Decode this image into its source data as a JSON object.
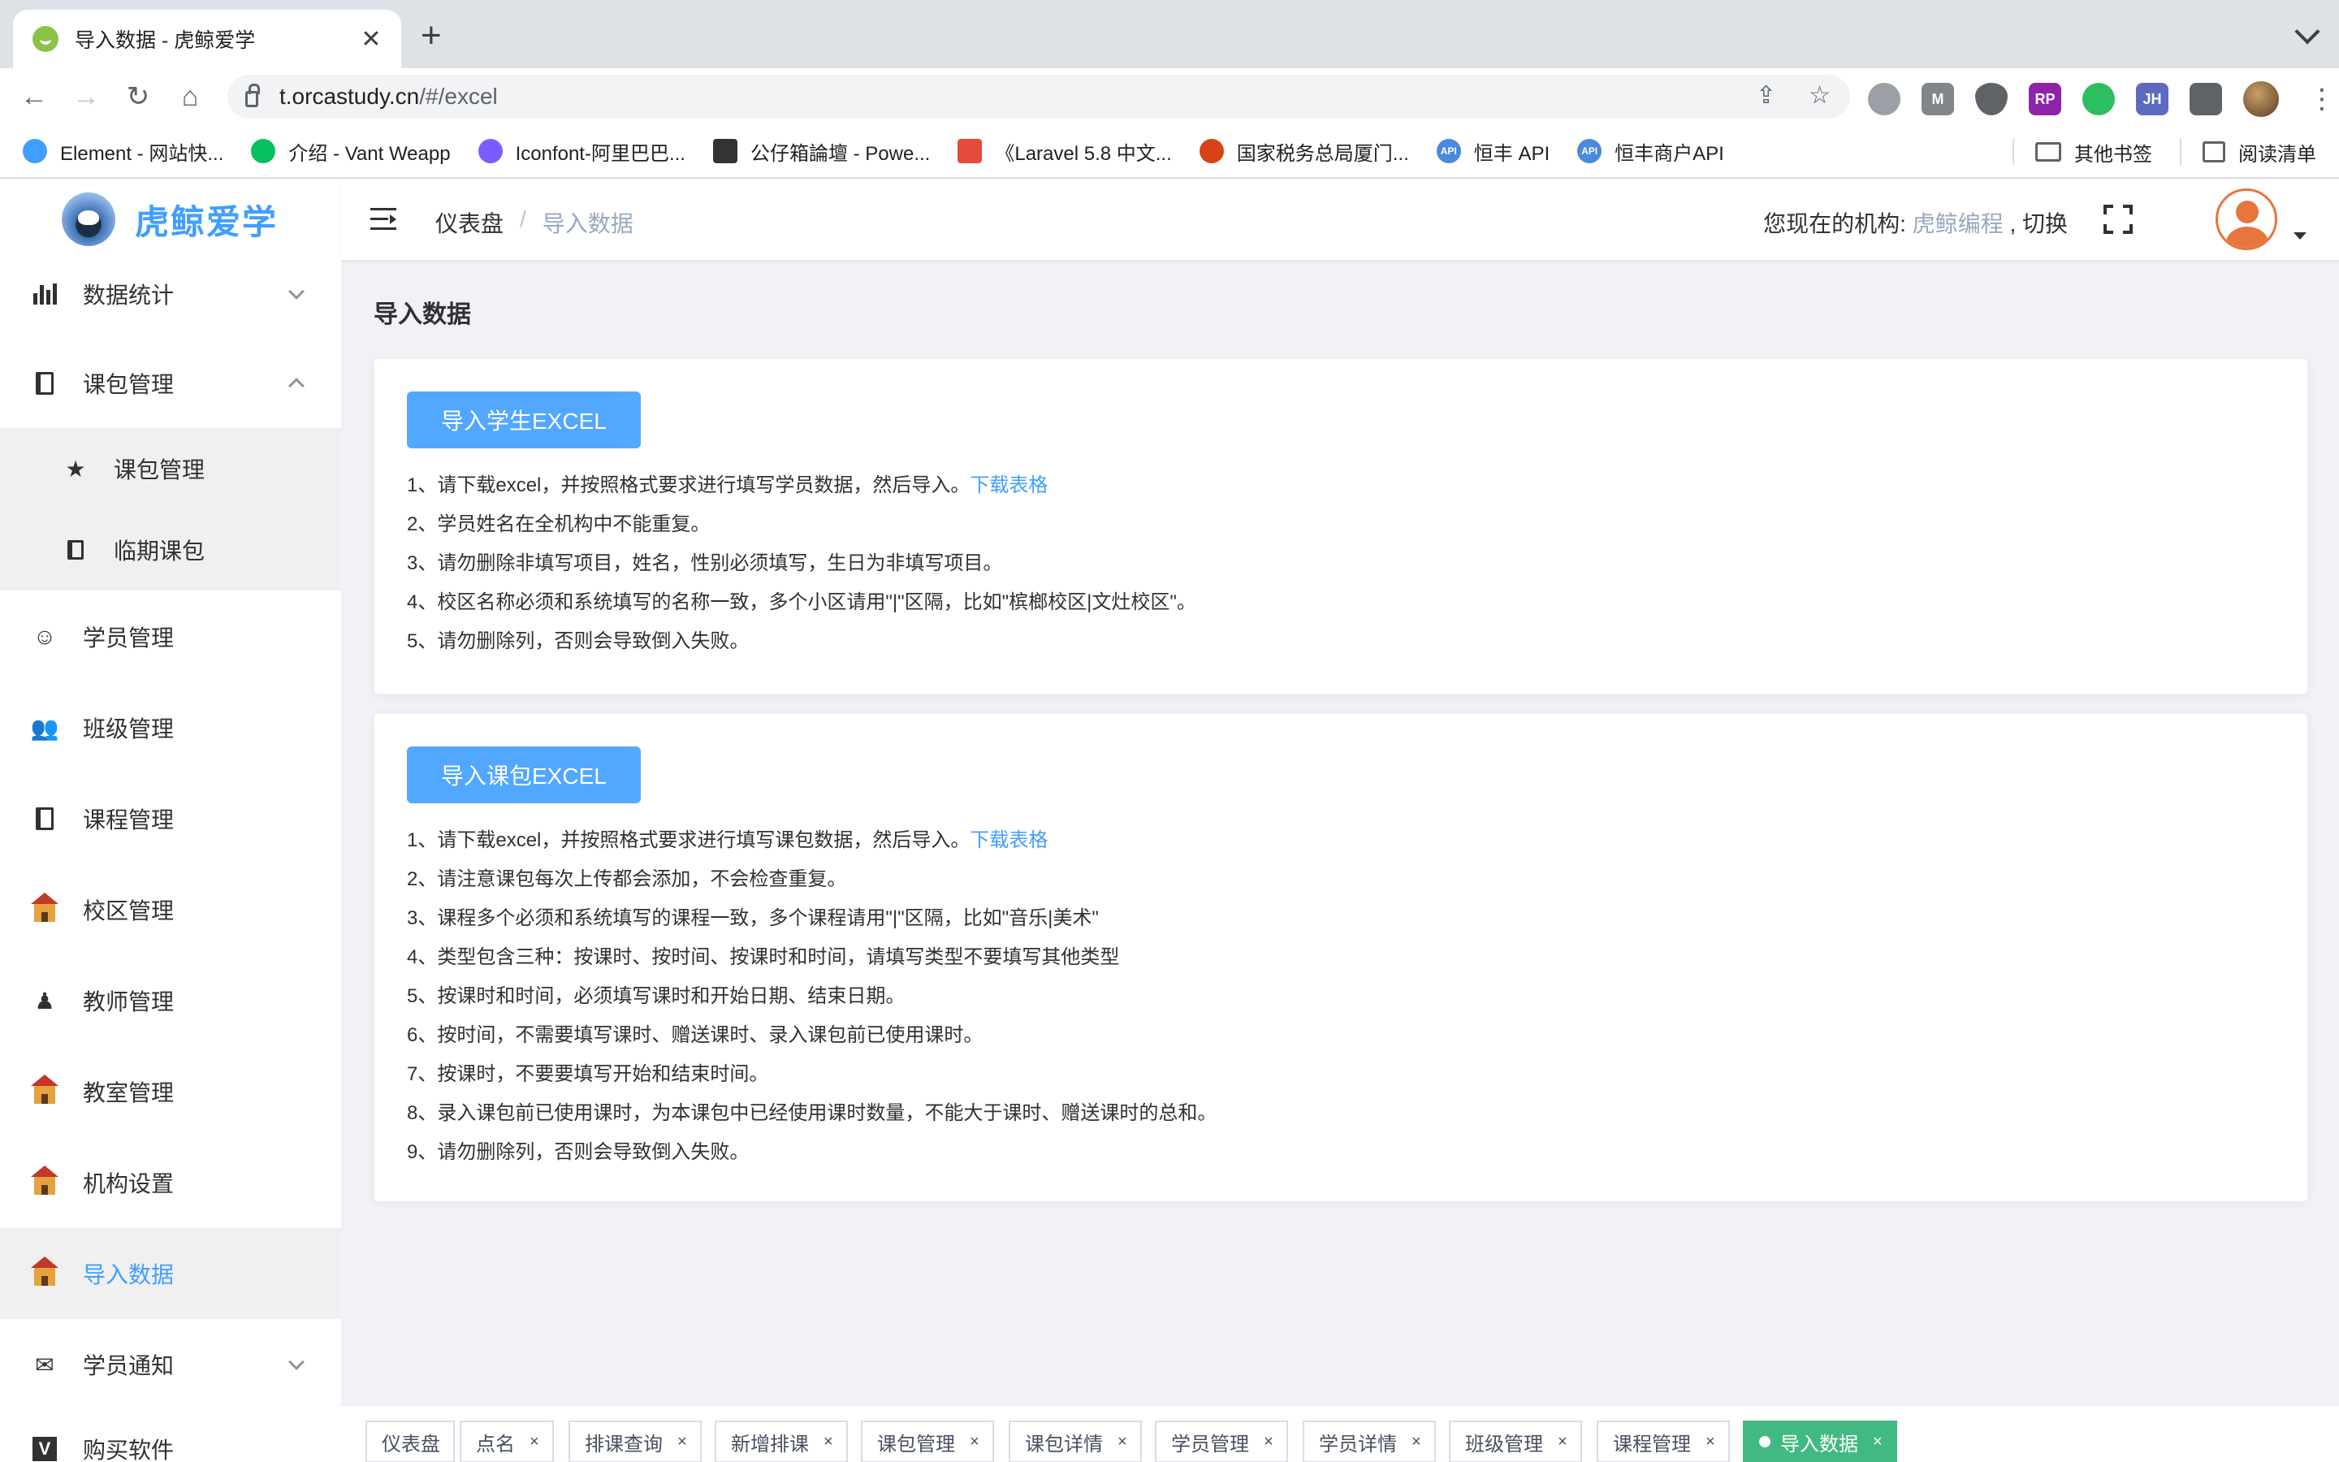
{
  "browser": {
    "tab_title": "导入数据 - 虎鲸爱学",
    "url_host": "t.orcastudy.cn",
    "url_path": "/#/excel",
    "bookmarks": [
      {
        "label": "Element - 网站快...",
        "color": "#409eff"
      },
      {
        "label": "介绍 - Vant Weapp",
        "color": "#07c160"
      },
      {
        "label": "Iconfont-阿里巴巴...",
        "color": "#7b5cff"
      },
      {
        "label": "公仔箱論壇 - Powe...",
        "color": "#333333"
      },
      {
        "label": "《Laravel 5.8 中文...",
        "color": "#e64a3b"
      },
      {
        "label": "国家税务总局厦门...",
        "color": "#d84315"
      },
      {
        "label": "恒丰 API",
        "color": "#4a89dc"
      },
      {
        "label": "恒丰商户API",
        "color": "#4a89dc"
      }
    ],
    "other_bookmarks": "其他书签",
    "reading_list": "阅读清单"
  },
  "app": {
    "logo_text": "虎鲸爱学",
    "breadcrumb": {
      "home": "仪表盘",
      "separator": "/",
      "current": "导入数据"
    },
    "org_prefix": "您现在的机构:",
    "org_name": "虎鲸编程",
    "org_switch": ", 切换"
  },
  "sidebar": {
    "items": [
      {
        "label": "数据统计"
      },
      {
        "label": "课包管理"
      },
      {
        "label": "课包管理"
      },
      {
        "label": "临期课包"
      },
      {
        "label": "学员管理"
      },
      {
        "label": "班级管理"
      },
      {
        "label": "课程管理"
      },
      {
        "label": "校区管理"
      },
      {
        "label": "教师管理"
      },
      {
        "label": "教室管理"
      },
      {
        "label": "机构设置"
      },
      {
        "label": "导入数据"
      },
      {
        "label": "学员通知"
      },
      {
        "label": "购买软件"
      }
    ]
  },
  "main": {
    "title": "导入数据",
    "student_card": {
      "button": "导入学生EXCEL",
      "notes": [
        "1、请下载excel，并按照格式要求进行填写学员数据，然后导入。",
        "2、学员姓名在全机构中不能重复。",
        "3、请勿删除非填写项目，姓名，性别必须填写，生日为非填写项目。",
        "4、校区名称必须和系统填写的名称一致，多个小区请用\"|\"区隔，比如\"槟榔校区|文灶校区\"。",
        "5、请勿删除列，否则会导致倒入失败。"
      ],
      "download_link": "下载表格"
    },
    "package_card": {
      "button": "导入课包EXCEL",
      "notes": [
        "1、请下载excel，并按照格式要求进行填写课包数据，然后导入。",
        "2、请注意课包每次上传都会添加，不会检查重复。",
        "3、课程多个必须和系统填写的课程一致，多个课程请用\"|\"区隔，比如\"音乐|美术\"",
        "4、类型包含三种：按课时、按时间、按课时和时间，请填写类型不要填写其他类型",
        "5、按课时和时间，必须填写课时和开始日期、结束日期。",
        "6、按时间，不需要填写课时、赠送课时、录入课包前已使用课时。",
        "7、按课时，不要要填写开始和结束时间。",
        "8、录入课包前已使用课时，为本课包中已经使用课时数量，不能大于课时、赠送课时的总和。",
        "9、请勿删除列，否则会导致倒入失败。"
      ],
      "download_link": "下载表格"
    }
  },
  "tags": [
    {
      "label": "仪表盘"
    },
    {
      "label": "点名"
    },
    {
      "label": "排课查询"
    },
    {
      "label": "新增排课"
    },
    {
      "label": "课包管理"
    },
    {
      "label": "课包详情"
    },
    {
      "label": "学员管理"
    },
    {
      "label": "学员详情"
    },
    {
      "label": "班级管理"
    },
    {
      "label": "课程管理"
    },
    {
      "label": "导入数据"
    }
  ],
  "tag_close": "×",
  "colors": {
    "primary": "#409eff",
    "active_tag": "#42b983"
  }
}
